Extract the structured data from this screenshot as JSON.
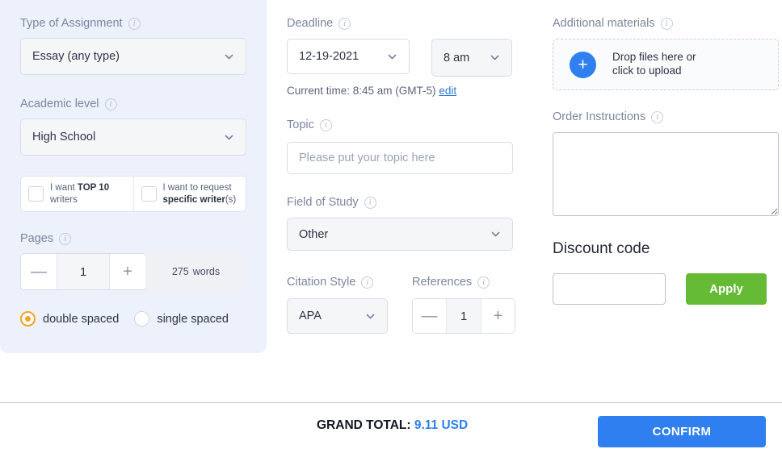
{
  "left": {
    "type_of_assignment": {
      "label": "Type of Assignment",
      "value": "Essay (any type)",
      "info": "info-icon"
    },
    "academic_level": {
      "label": "Academic level",
      "value": "High School",
      "info": "info-icon"
    },
    "writer_options": [
      {
        "prefix": "I want ",
        "strong": "TOP 10",
        "suffix": " writers",
        "checked": false
      },
      {
        "prefix": "I want to request ",
        "strong": "specific writer",
        "suffix": "(s)",
        "checked": false
      }
    ],
    "pages": {
      "label": "Pages",
      "value": "1",
      "minus": "—",
      "plus": "+",
      "words_count": "275",
      "words_label": "words"
    },
    "spacing": {
      "options": [
        "double spaced",
        "single spaced"
      ],
      "selected": "double spaced"
    }
  },
  "middle": {
    "deadline": {
      "label": "Deadline",
      "date": "12-19-2021",
      "time": "8 am"
    },
    "current_time": {
      "text": "Current time: 8:45 am (GMT-5)",
      "edit_label": "edit"
    },
    "topic": {
      "label": "Topic",
      "value": "",
      "placeholder": "Please put your topic here"
    },
    "field_of_study": {
      "label": "Field of Study",
      "value": "Other"
    },
    "citation_style": {
      "label": "Citation Style",
      "value": "APA"
    },
    "references": {
      "label": "References",
      "value": "1",
      "minus": "—",
      "plus": "+"
    }
  },
  "right": {
    "additional_materials": {
      "label": "Additional materials",
      "upload_text": "Drop files here or\nclick to upload",
      "plus": "+"
    },
    "order_instructions": {
      "label": "Order Instructions",
      "value": "",
      "placeholder": ""
    },
    "discount": {
      "title": "Discount code",
      "value": "",
      "placeholder": "",
      "apply_label": "Apply"
    }
  },
  "footer": {
    "grand_total_label": "GRAND TOTAL:",
    "grand_total_amount": "9.11 USD",
    "confirm_label": "CONFIRM"
  },
  "colors": {
    "panel_bg": "#edf1fb",
    "accent_blue": "#2f7ff0",
    "apply_green": "#66bb36",
    "radio_orange": "#f4a224"
  }
}
